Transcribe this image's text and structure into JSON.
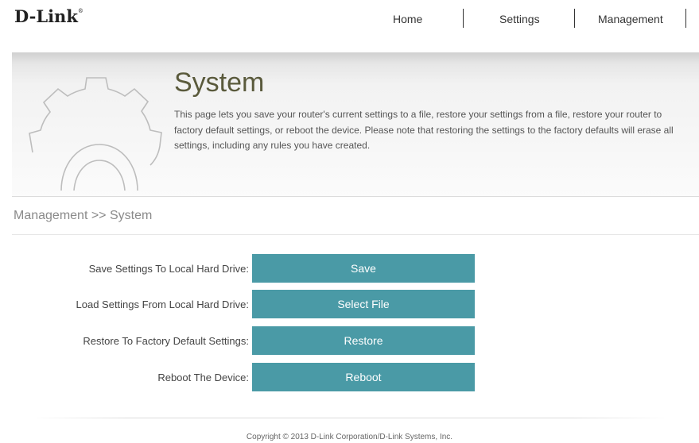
{
  "brand": {
    "logo_text": "D-Link",
    "logo_mark": "®"
  },
  "nav": {
    "home": "Home",
    "settings": "Settings",
    "management": "Management"
  },
  "banner": {
    "title": "System",
    "description": "This page lets you save your router's current settings to a file, restore your settings from a file, restore your router to factory default settings, or reboot the device. Please note that restoring the settings to the factory defaults will erase all settings, including any rules you have created.",
    "icon": "gear-icon"
  },
  "breadcrumb": "Management >> System",
  "actions": [
    {
      "label": "Save Settings To Local Hard Drive:",
      "button": "Save"
    },
    {
      "label": "Load Settings From Local Hard Drive:",
      "button": "Select File"
    },
    {
      "label": "Restore To Factory Default Settings:",
      "button": "Restore"
    },
    {
      "label": "Reboot The Device:",
      "button": "Reboot"
    }
  ],
  "footer": {
    "copyright": "Copyright © 2013 D-Link Corporation/D-Link Systems, Inc."
  },
  "colors": {
    "button_bg": "#4a9aa6",
    "title": "#5a5a3c"
  }
}
